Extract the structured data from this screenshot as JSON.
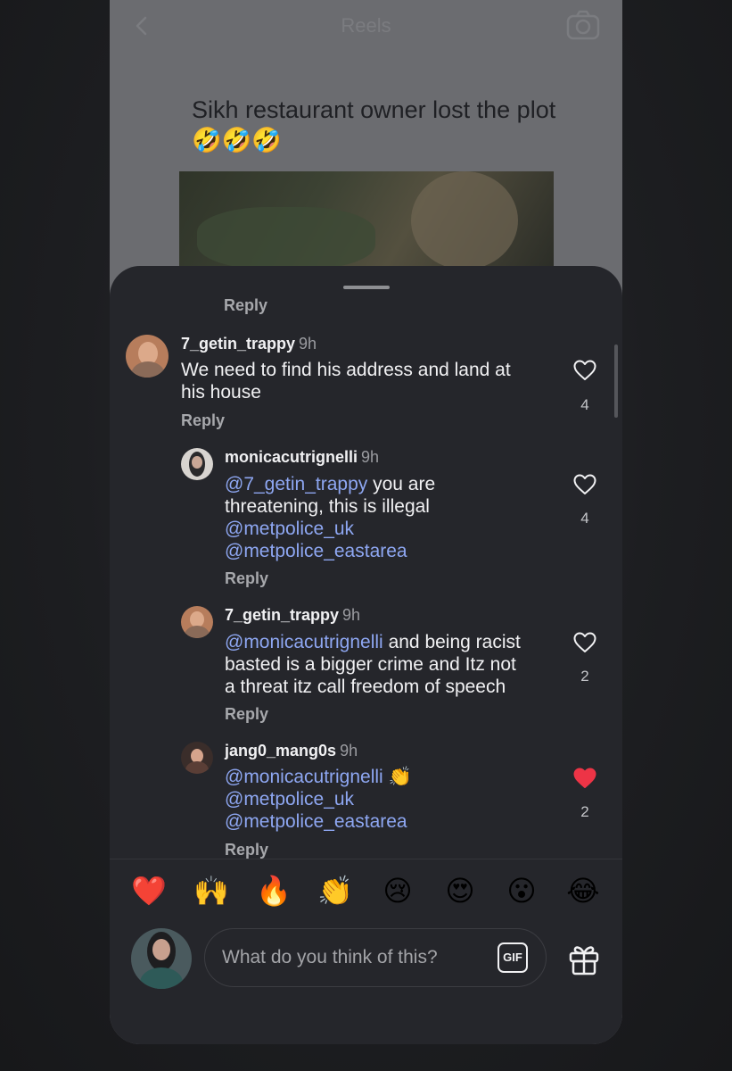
{
  "reel": {
    "title": "Reels",
    "caption": "Sikh restaurant owner lost the plot 🤣🤣🤣"
  },
  "sheet": {
    "top_reply_label": "Reply",
    "comments": [
      {
        "username": "7_getin_trappy",
        "time": "9h",
        "line1": "We need to find his address and land at",
        "line2": "his house",
        "reply_label": "Reply",
        "likes": "4",
        "liked": false
      },
      {
        "username": "monicacutrignelli",
        "time": "9h",
        "mention1": "@7_getin_trappy",
        "line1_rest": " you are",
        "line2": "threatening, this is illegal",
        "mention2": "@metpolice_uk",
        "mention3": "@metpolice_eastarea",
        "reply_label": "Reply",
        "likes": "4",
        "liked": false
      },
      {
        "username": "7_getin_trappy",
        "time": "9h",
        "mention1": "@monicacutrignelli",
        "line1_rest": " and being racist",
        "line2": "basted is a bigger crime and Itz not",
        "line3": "a threat itz call freedom of speech",
        "reply_label": "Reply",
        "likes": "2",
        "liked": false
      },
      {
        "username": "jang0_mang0s",
        "time": "9h",
        "mention1": "@monicacutrignelli",
        "line1_rest": " 👏",
        "mention2": "@metpolice_uk",
        "mention3": "@metpolice_eastarea",
        "reply_label": "Reply",
        "likes": "2",
        "liked": true
      }
    ],
    "quick_reactions": [
      "❤️",
      "🙌",
      "🔥",
      "👏",
      "😢",
      "😍",
      "😮",
      "😂"
    ],
    "composer": {
      "placeholder": "What do you think of this?",
      "gif_label": "GIF"
    }
  },
  "colors": {
    "sheet_bg": "#25262b",
    "mention": "#8ea7f2",
    "liked_heart": "#ed3446",
    "text": "#f1f1f3",
    "muted": "#a7a8ac"
  },
  "icons": [
    "back-arrow-icon",
    "camera-icon",
    "heart-outline-icon",
    "heart-filled-icon",
    "gif-icon",
    "gift-icon"
  ]
}
